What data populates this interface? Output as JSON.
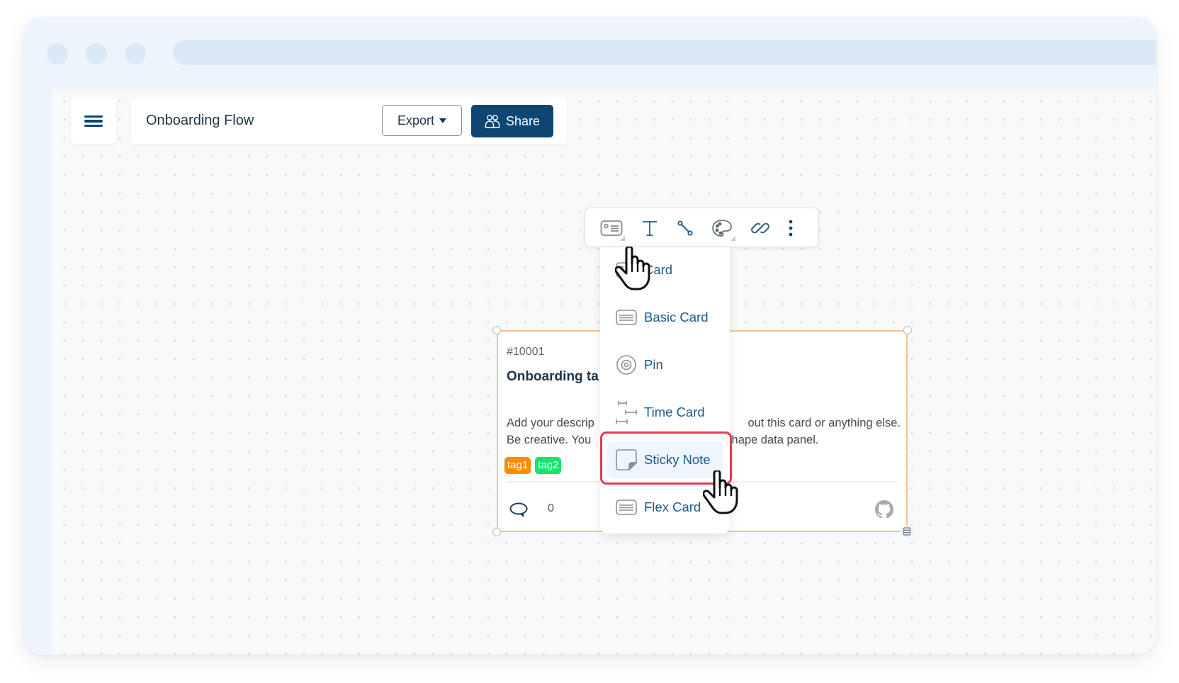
{
  "window": {
    "controls": [
      "close",
      "minimize",
      "maximize"
    ]
  },
  "header": {
    "menu_icon": "hamburger-menu-icon",
    "document_title": "Onboarding Flow",
    "export_label": "Export",
    "share_label": "Share",
    "share_icon": "users-icon"
  },
  "toolbar": {
    "tools": [
      {
        "name": "card-shape",
        "icon": "card-icon",
        "has_submenu": true
      },
      {
        "name": "text",
        "icon": "text-icon",
        "has_submenu": false
      },
      {
        "name": "connector",
        "icon": "connector-icon",
        "has_submenu": false
      },
      {
        "name": "color",
        "icon": "palette-icon",
        "has_submenu": true
      },
      {
        "name": "link",
        "icon": "link-icon",
        "has_submenu": false
      },
      {
        "name": "more",
        "icon": "more-vertical-icon",
        "has_submenu": false
      }
    ]
  },
  "shape_menu": {
    "items": [
      {
        "label": "Card",
        "icon": "card-icon"
      },
      {
        "label": "Basic Card",
        "icon": "basic-card-icon"
      },
      {
        "label": "Pin",
        "icon": "pin-icon"
      },
      {
        "label": "Time Card",
        "icon": "time-card-icon"
      },
      {
        "label": "Sticky Note",
        "icon": "sticky-note-icon",
        "highlighted": true
      },
      {
        "label": "Flex Card",
        "icon": "flex-card-icon"
      }
    ]
  },
  "card": {
    "id": "#10001",
    "title": "Onboarding ta",
    "description_line1_left": "Add your descrip",
    "description_line1_right": "out this card or anything else.",
    "description_line2_left": "Be creative. You",
    "description_line2_right": "shape data panel.",
    "tags": [
      {
        "label": "tag1",
        "color": "#fb8c00"
      },
      {
        "label": "tag2",
        "color": "#18e36a"
      }
    ],
    "comment_count": "0"
  },
  "colors": {
    "primary": "#0d4673",
    "menu_text": "#1c5a8a",
    "selection_border": "#fcc08e",
    "highlight_border": "#e63a4f"
  }
}
